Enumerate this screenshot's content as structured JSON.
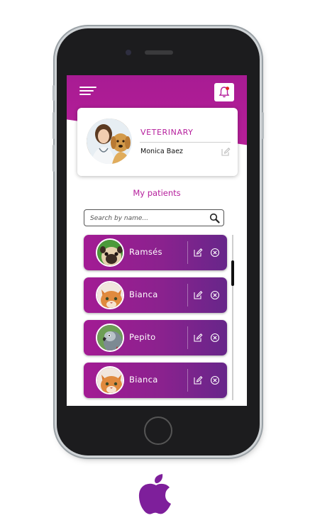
{
  "header": {
    "menu_icon": "hamburger-menu-icon",
    "notification_icon": "bell-icon",
    "accent_color": "#b51e9c"
  },
  "profile": {
    "role": "VETERINARY",
    "name": "Monica Baez",
    "edit_icon": "edit-icon"
  },
  "patients_section": {
    "title": "My patients"
  },
  "search": {
    "placeholder": "Search by name...",
    "icon": "search-icon"
  },
  "patients": [
    {
      "name": "Ramsés",
      "avatar": "pug-dog"
    },
    {
      "name": "Bianca",
      "avatar": "orange-cat"
    },
    {
      "name": "Pepito",
      "avatar": "parrot"
    },
    {
      "name": "Bianca",
      "avatar": "orange-cat"
    }
  ],
  "platform_icon": "apple-logo-icon",
  "platform_color": "#7e1f9b"
}
